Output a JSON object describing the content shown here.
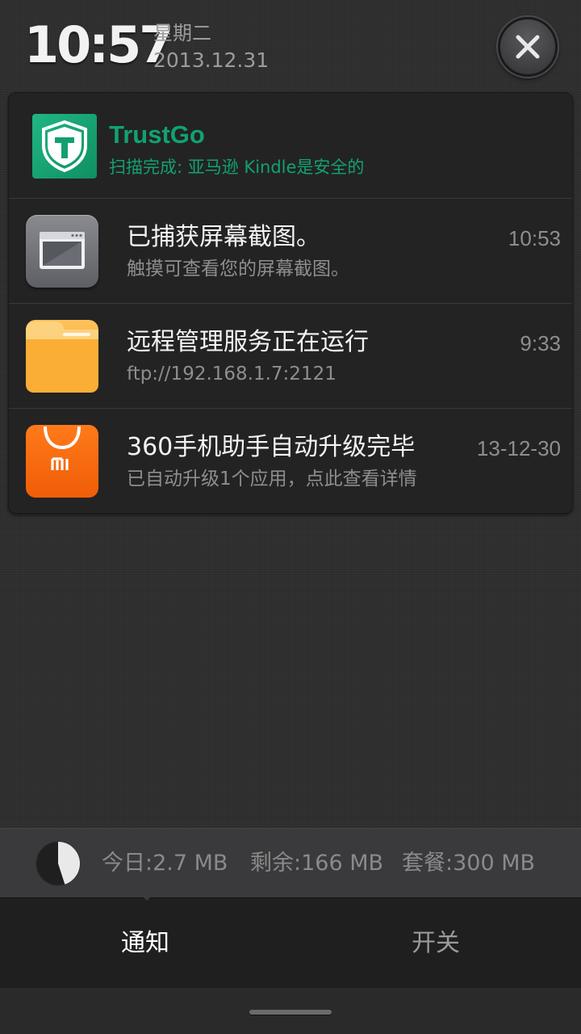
{
  "header": {
    "time": "10:57",
    "weekday": "星期二",
    "date": "2013.12.31"
  },
  "notifications": [
    {
      "app": "TrustGo",
      "icon": "trustgo-shield-icon",
      "title": "TrustGo",
      "subtitle": "扫描完成: 亚马逊 Kindle是安全的",
      "color": "#11a26e"
    },
    {
      "app": "screenshot",
      "icon": "screenshot-window-icon",
      "title": "已捕获屏幕截图。",
      "subtitle": "触摸可查看您的屏幕截图。",
      "time": "10:53"
    },
    {
      "app": "file-manager",
      "icon": "folder-icon",
      "title": "远程管理服务正在运行",
      "subtitle": "ftp://192.168.1.7:2121",
      "time": "9:33"
    },
    {
      "app": "mi-store",
      "icon": "mi-shopping-bag-icon",
      "title": "360手机助手自动升级完毕",
      "subtitle": "已自动升级1个应用，点此查看详情",
      "time": "13-12-30"
    }
  ],
  "data_usage": {
    "today": "今日:2.7 MB",
    "remaining": "剩余:166 MB",
    "plan": "套餐:300 MB",
    "used_fraction": 0.45
  },
  "tabs": {
    "notifications": "通知",
    "toggles": "开关",
    "active": "notifications"
  }
}
